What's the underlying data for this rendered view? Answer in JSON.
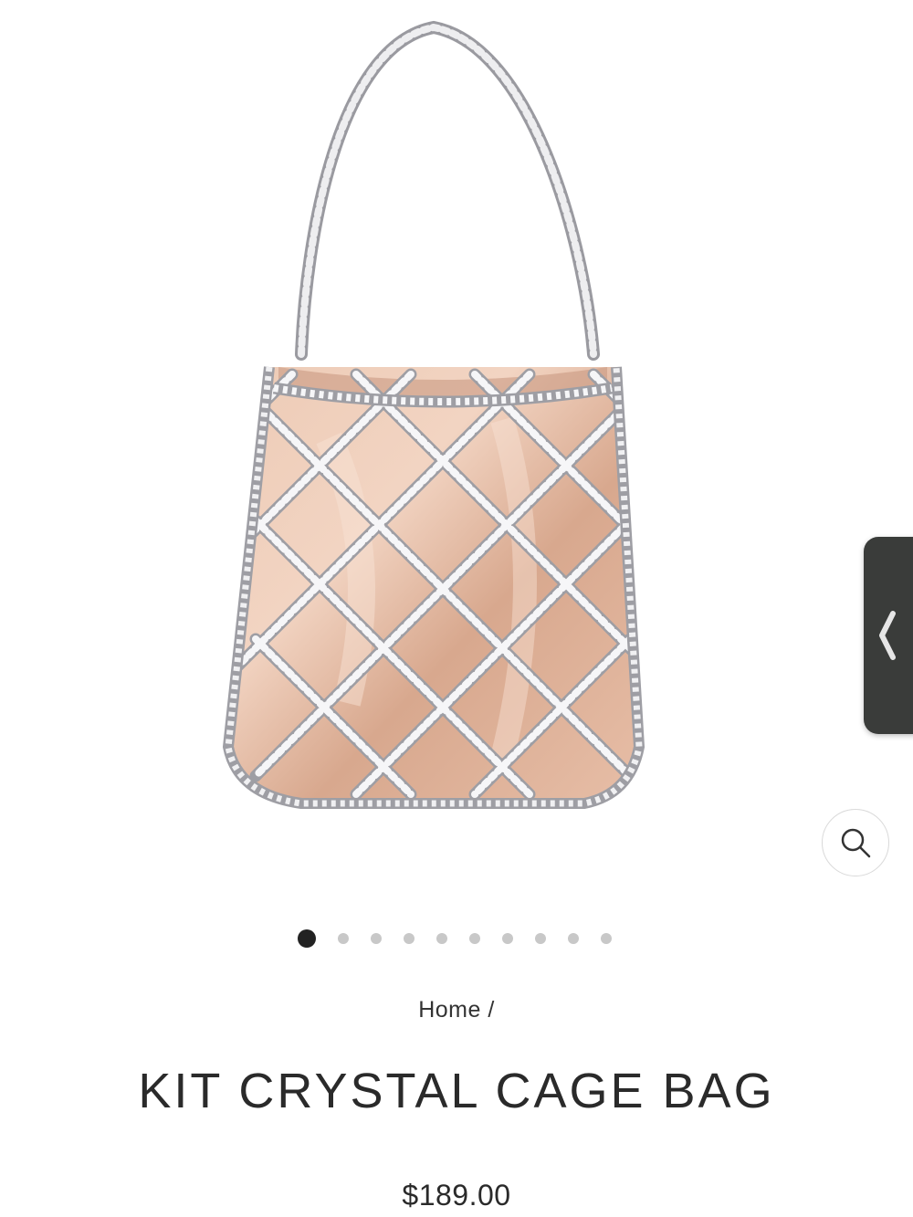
{
  "gallery": {
    "image_alt": "",
    "slide_count": 10,
    "active_slide": 1,
    "colors": {
      "satin": "#e2b8a0",
      "crystal": "#e8e8ea",
      "side_tab": "#3a3c3a"
    }
  },
  "icons": {
    "zoom": "magnifier-icon",
    "side_tab": "chevron-left-icon"
  },
  "breadcrumb": {
    "home": "Home",
    "separator": "/"
  },
  "product": {
    "title": "KIT CRYSTAL CAGE BAG",
    "price": "$189.00"
  }
}
